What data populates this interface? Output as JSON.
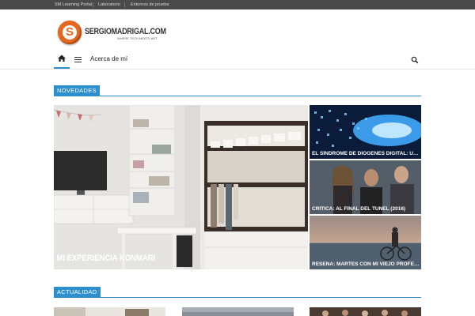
{
  "topbar": {
    "links": [
      "SM Learning Portal",
      "Laboratorio",
      "Entornos de prueba"
    ]
  },
  "header": {
    "logo_letter": "S",
    "site_name": "SERGIOMADRIGAL.COM",
    "tagline": "WHERE TECH MEETS ART"
  },
  "nav": {
    "home_icon": "home-icon",
    "menu_icon": "hamburger-icon",
    "link_about": "Acerca de mí",
    "search_icon": "search-icon"
  },
  "sections": {
    "novedades": "NOVEDADES",
    "actualidad": "ACTUALIDAD"
  },
  "featured": {
    "main_caption": "MI EXPERIENCIA KONMARI",
    "side": [
      "EL SÍNDROME DE DIÓGENES DIGITAL: UN...",
      "CRÍTICA: AL FINAL DEL TÚNEL (2016)",
      "RESEÑA: MARTES CON MI VIEJO PROFESOR..."
    ]
  },
  "colors": {
    "accent": "#2d8fcd",
    "logo": "#e2691f",
    "topbar": "#4a4a4a"
  }
}
